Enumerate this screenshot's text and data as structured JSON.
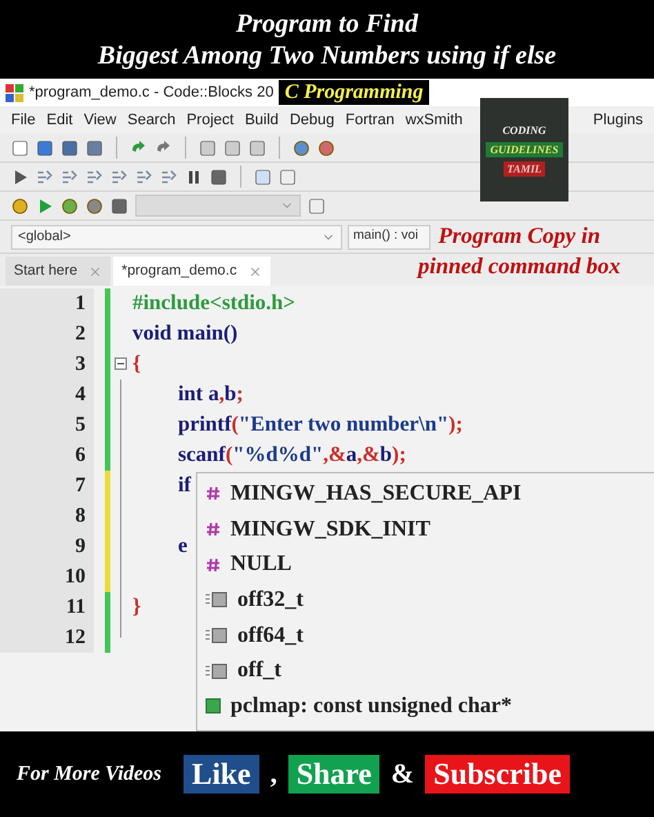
{
  "overlay": {
    "title_lines": [
      "Program to Find",
      "Biggest Among Two Numbers using if else"
    ],
    "caption": "C Programming",
    "note_lines": [
      "Program Copy in",
      "pinned command box"
    ],
    "logo_lines": [
      "CODING",
      "GUIDELINES",
      "TAMIL"
    ]
  },
  "window": {
    "title": "*program_demo.c - Code::Blocks 20"
  },
  "menu": [
    "File",
    "Edit",
    "View",
    "Search",
    "Project",
    "Build",
    "Debug",
    "Fortran",
    "wxSmith",
    "Plugins"
  ],
  "scope_bar": {
    "scope": "<global>",
    "function": "main() : voi"
  },
  "tabs": [
    {
      "label": "Start here",
      "selected": false
    },
    {
      "label": "*program_demo.c",
      "selected": true
    }
  ],
  "editor": {
    "lines": [
      {
        "number": "1",
        "modified": false,
        "indented": false,
        "fold_start": false,
        "tokens": [
          {
            "text": "#include<stdio.h>",
            "kind": "pre"
          }
        ]
      },
      {
        "number": "2",
        "modified": false,
        "indented": false,
        "fold_start": false,
        "tokens": [
          {
            "text": "void main()",
            "kind": "code"
          }
        ]
      },
      {
        "number": "3",
        "modified": false,
        "indented": false,
        "fold_start": true,
        "tokens": [
          {
            "text": "{",
            "kind": "op"
          }
        ]
      },
      {
        "number": "4",
        "modified": false,
        "indented": true,
        "fold_start": false,
        "tokens": [
          {
            "text": "int a",
            "kind": "code"
          },
          {
            "text": ",",
            "kind": "op"
          },
          {
            "text": "b",
            "kind": "code"
          },
          {
            "text": ";",
            "kind": "op"
          }
        ]
      },
      {
        "number": "5",
        "modified": false,
        "indented": true,
        "fold_start": false,
        "tokens": [
          {
            "text": "printf",
            "kind": "code"
          },
          {
            "text": "(",
            "kind": "op"
          },
          {
            "text": "\"Enter two number\\n\"",
            "kind": "string"
          },
          {
            "text": ");",
            "kind": "op"
          }
        ]
      },
      {
        "number": "6",
        "modified": false,
        "indented": true,
        "fold_start": false,
        "tokens": [
          {
            "text": "scanf",
            "kind": "code"
          },
          {
            "text": "(",
            "kind": "op"
          },
          {
            "text": "\"%d%d\"",
            "kind": "string"
          },
          {
            "text": ",&",
            "kind": "op"
          },
          {
            "text": "a",
            "kind": "code"
          },
          {
            "text": ",&",
            "kind": "op"
          },
          {
            "text": "b",
            "kind": "code"
          },
          {
            "text": ");",
            "kind": "op"
          }
        ]
      },
      {
        "number": "7",
        "modified": true,
        "indented": true,
        "fold_start": false,
        "tokens": [
          {
            "text": "if",
            "kind": "code"
          }
        ]
      },
      {
        "number": "8",
        "modified": true,
        "fold_start": false
      },
      {
        "number": "9",
        "modified": true,
        "indented": true,
        "fold_start": false,
        "tokens": [
          {
            "text": "e",
            "kind": "code"
          }
        ]
      },
      {
        "number": "10",
        "modified": true,
        "fold_start": false
      },
      {
        "number": "11",
        "modified": false,
        "indented": false,
        "fold_start": false,
        "tokens": [
          {
            "text": "}",
            "kind": "op"
          }
        ]
      },
      {
        "number": "12",
        "modified": false,
        "fold_start": false
      }
    ]
  },
  "autocomplete": [
    {
      "kind": "macro",
      "label": "MINGW_HAS_SECURE_API"
    },
    {
      "kind": "macro",
      "label": "MINGW_SDK_INIT"
    },
    {
      "kind": "macro",
      "label": "NULL"
    },
    {
      "kind": "typedef",
      "label": "off32_t"
    },
    {
      "kind": "typedef",
      "label": "off64_t"
    },
    {
      "kind": "typedef",
      "label": "off_t"
    },
    {
      "kind": "variable",
      "label": "pclmap: const unsigned char*"
    }
  ],
  "footer": [
    {
      "kind": "lead",
      "text": "For More Videos"
    },
    {
      "kind": "button",
      "text": "Like",
      "color": "#1f4e8a"
    },
    {
      "kind": "separator",
      "text": ","
    },
    {
      "kind": "button",
      "text": "Share",
      "color": "#12a150"
    },
    {
      "kind": "separator",
      "text": "&"
    },
    {
      "kind": "button",
      "text": "Subscribe",
      "color": "#e8141a"
    }
  ]
}
